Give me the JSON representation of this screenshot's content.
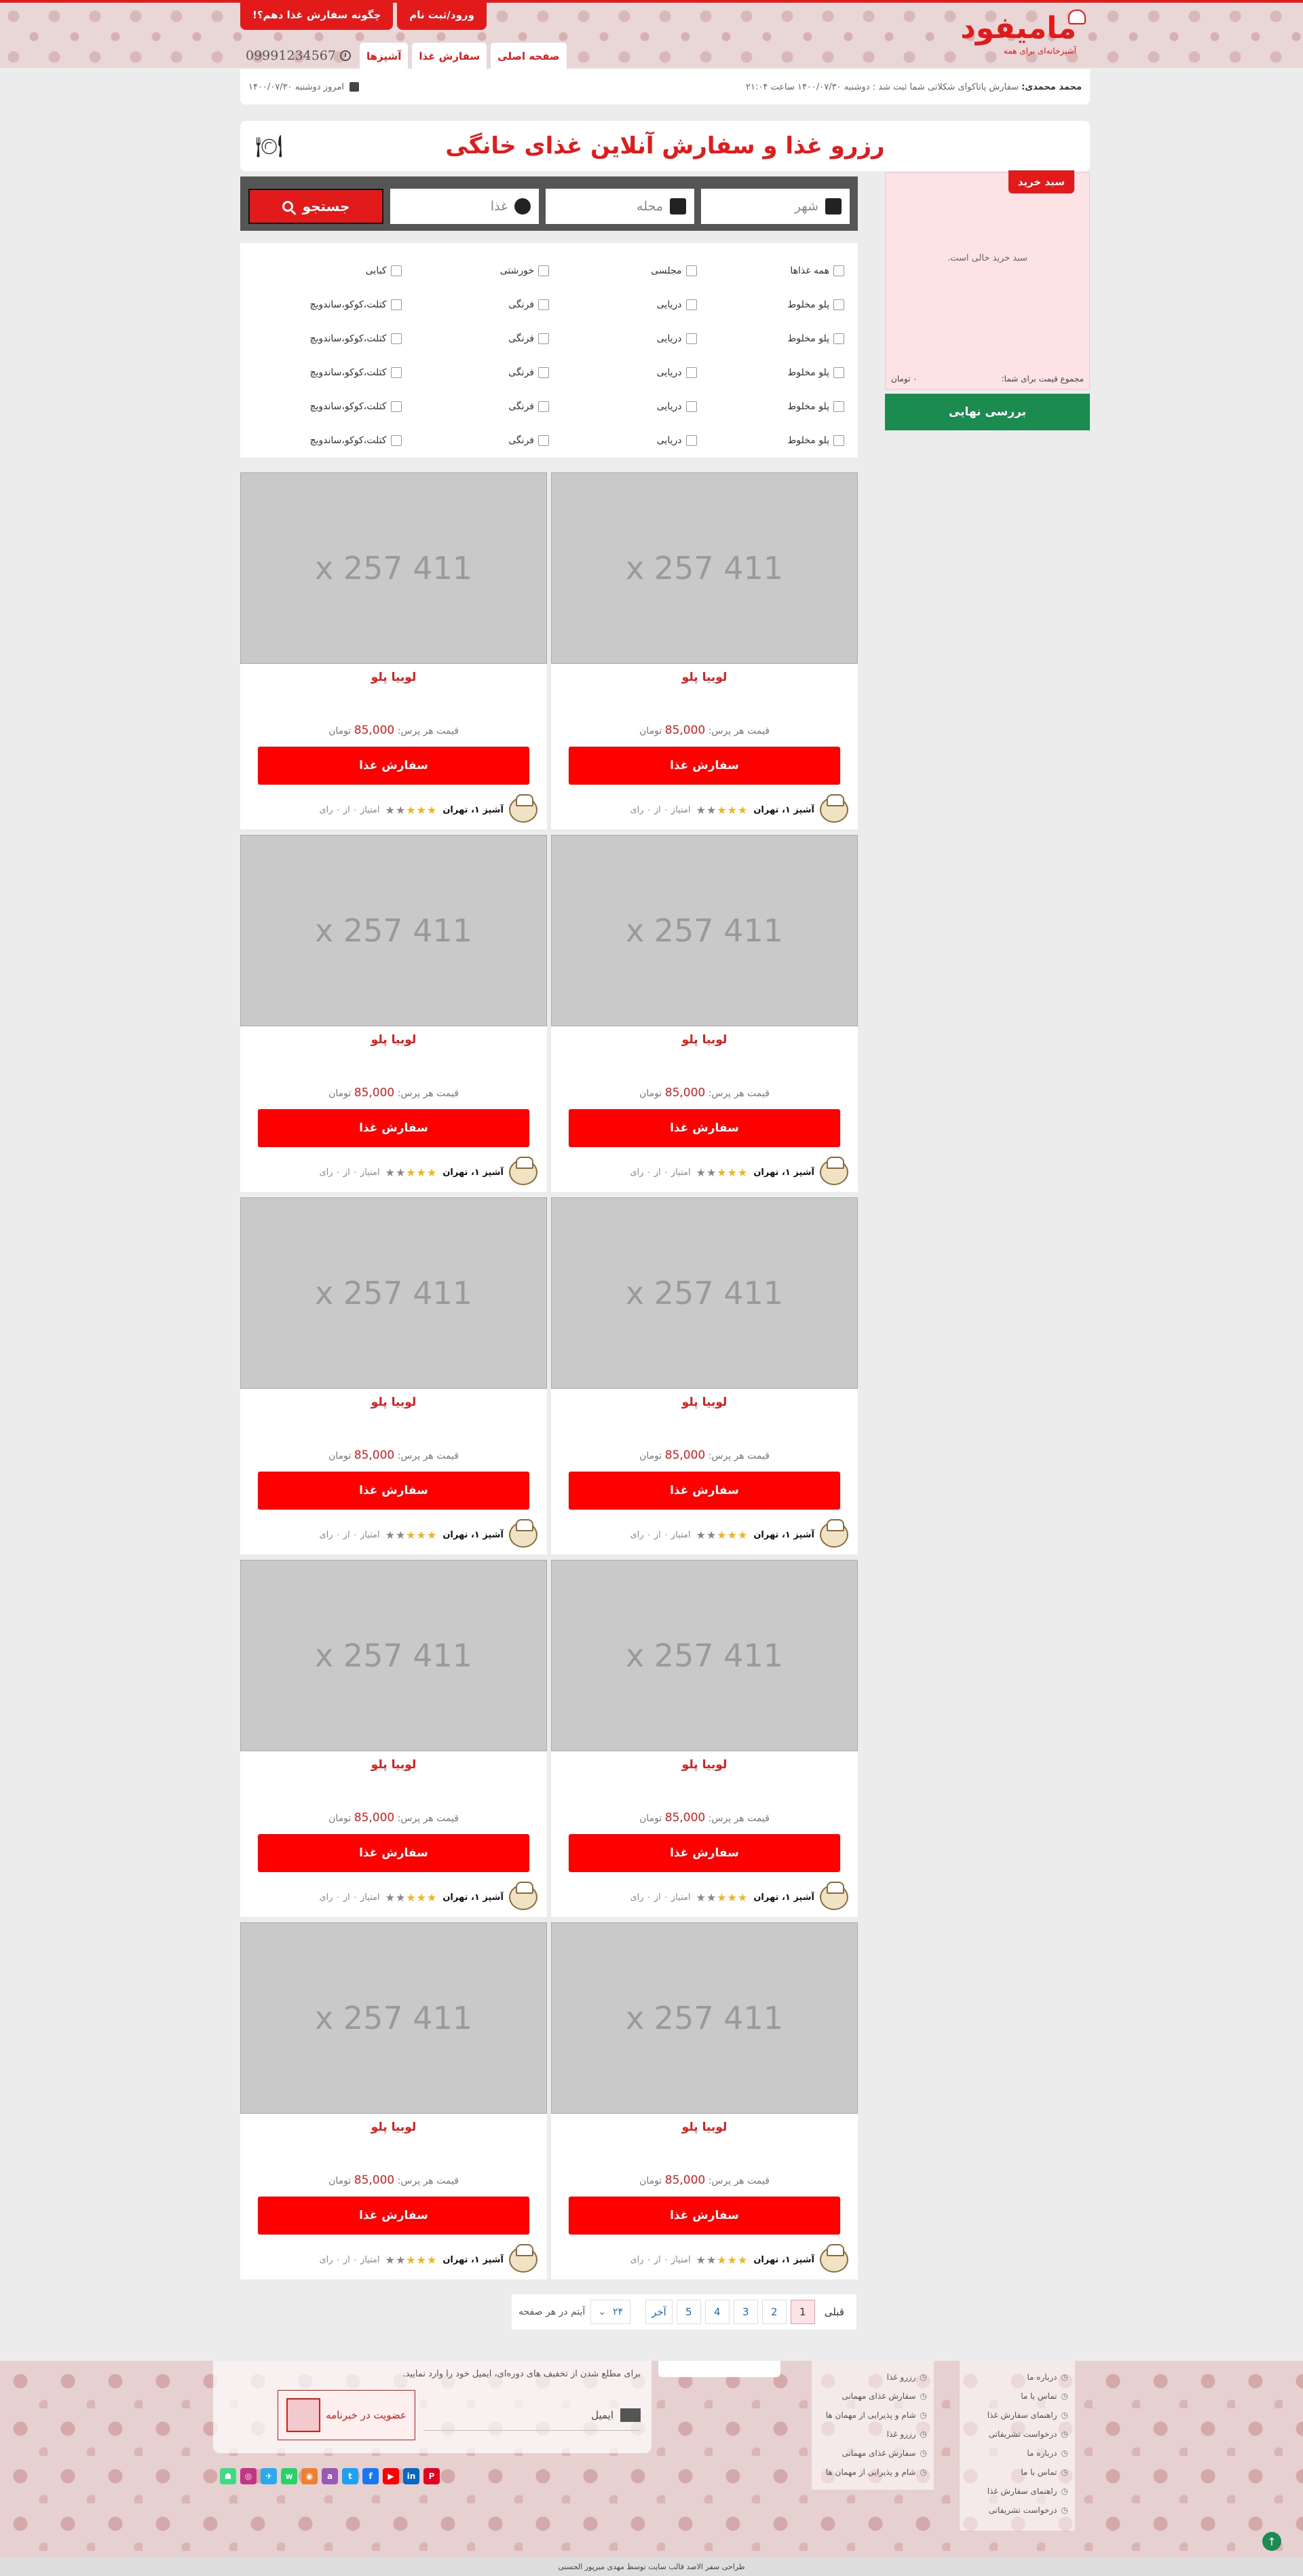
{
  "header": {
    "brand": "مامیفود",
    "tagline": "آشپزخانه‌ای برای همه",
    "login_button": "ورود/ثبت نام",
    "how_to_order_button": "چگونه سفارش غذا دهم؟!",
    "phone": "09991234567",
    "nav": [
      "صفحه اصلی",
      "سفارش غذا",
      "آشپزها"
    ]
  },
  "ticker": {
    "author": "محمد محمدی:",
    "message": "سفارش پاتاکوای شکلاتی شما ثبت شد : دوشنبه ۱۴۰۰/۰۷/۳۰ ساعت ۲۱:۰۴",
    "date": "امروز دوشنبه ۱۴۰۰/۰۷/۳۰"
  },
  "page_title": "رزرو غذا و سفارش آنلاین غذای خانگی",
  "search": {
    "city": "شهر",
    "district": "محله",
    "food": "غذا",
    "button": "جستجو"
  },
  "filters": [
    [
      "همه غذاها",
      "مجلسی",
      "خورشتی",
      "کبابی"
    ],
    [
      "پلو مخلوط",
      "دریایی",
      "فرنگی",
      "کتلت،کوکو،ساندویچ"
    ],
    [
      "پلو مخلوط",
      "دریایی",
      "فرنگی",
      "کتلت،کوکو،ساندویچ"
    ],
    [
      "پلو مخلوط",
      "دریایی",
      "فرنگی",
      "کتلت،کوکو،ساندویچ"
    ],
    [
      "پلو مخلوط",
      "دریایی",
      "فرنگی",
      "کتلت،کوکو،ساندویچ"
    ],
    [
      "پلو مخلوط",
      "دریایی",
      "فرنگی",
      "کتلت،کوکو،ساندویچ"
    ]
  ],
  "cart": {
    "label": "سبد خرید",
    "empty": "سبد خرید خالی است.",
    "total_label": "مجموع قیمت برای شما:",
    "total_value": "۰ تومان",
    "checkout_button": "بررسی نهایی"
  },
  "product": {
    "placeholder": "411 x 257",
    "name": "لوبیا پلو",
    "price_label": "قیمت هر پرس:",
    "price": "85,000",
    "currency": "تومان",
    "order_button": "سفارش غذا",
    "cook_label": "آشپز ۱، تهران",
    "score_label": "امتیاز ۰ از ۰ رای",
    "rating": 3
  },
  "pagination": {
    "prev": "قبلی",
    "pages": [
      "1",
      "2",
      "3",
      "4",
      "5"
    ],
    "last": "آخر",
    "per_page_value": "۲۴",
    "per_page_label": "آیتم در هر صفحه"
  },
  "footer": {
    "newsletter_text": "برای مطلع شدن از تخفیف های دوره‌ای، ایمیل خود را وارد نمایید.",
    "email_label": "ایمیل",
    "subscribe": "عضویت در خبرنامه",
    "col1": [
      "درباره ما",
      "تماس با ما",
      "راهنمای سفارش غذا",
      "درخواست تشریفاتی",
      "درباره ما",
      "تماس با ما",
      "راهنمای سفارش غذا",
      "درخواست تشریفاتی"
    ],
    "col2": [
      "رزرو غذا",
      "سفارش غذای مهمانی",
      "شام و پذیرایی از مهمان ها",
      "رزرو غذا",
      "سفارش غذای مهمانی",
      "شام و پذیرایی از مهمان ها"
    ],
    "copyright": "طراحی سفر الاصد قالب سایت توسط مهدی میرپور الحسنی"
  },
  "colors": {
    "accent": "#e21a1a",
    "success": "#1c8b4f",
    "cart_bg": "#fde3e6"
  }
}
